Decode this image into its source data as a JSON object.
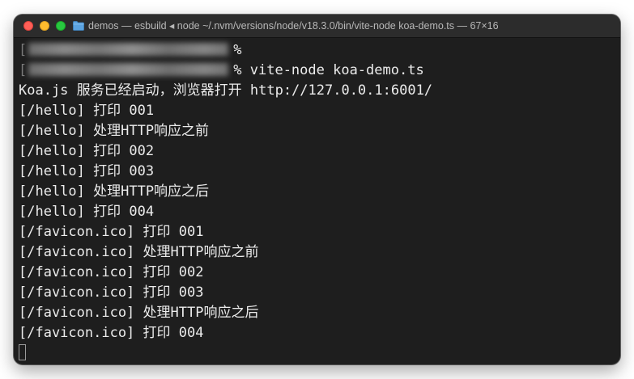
{
  "window": {
    "title": "demos — esbuild ◂ node ~/.nvm/versions/node/v18.3.0/bin/vite-node koa-demo.ts — 67×16",
    "folder_icon": "folder-icon"
  },
  "terminal": {
    "prompts": [
      {
        "symbol": "%",
        "command": ""
      },
      {
        "symbol": "%",
        "command": "vite-node koa-demo.ts"
      }
    ],
    "output": [
      "Koa.js 服务已经启动，浏览器打开 http://127.0.0.1:6001/",
      "[/hello] 打印 001",
      "[/hello] 处理HTTP响应之前",
      "[/hello] 打印 002",
      "[/hello] 打印 003",
      "[/hello] 处理HTTP响应之后",
      "[/hello] 打印 004",
      "[/favicon.ico] 打印 001",
      "[/favicon.ico] 处理HTTP响应之前",
      "[/favicon.ico] 打印 002",
      "[/favicon.ico] 打印 003",
      "[/favicon.ico] 处理HTTP响应之后",
      "[/favicon.ico] 打印 004"
    ]
  },
  "colors": {
    "background": "#1e1e1e",
    "text": "#ececec",
    "titlebar": "#2c2c2c",
    "close": "#ff5f57",
    "minimize": "#febc2e",
    "maximize": "#28c840"
  }
}
